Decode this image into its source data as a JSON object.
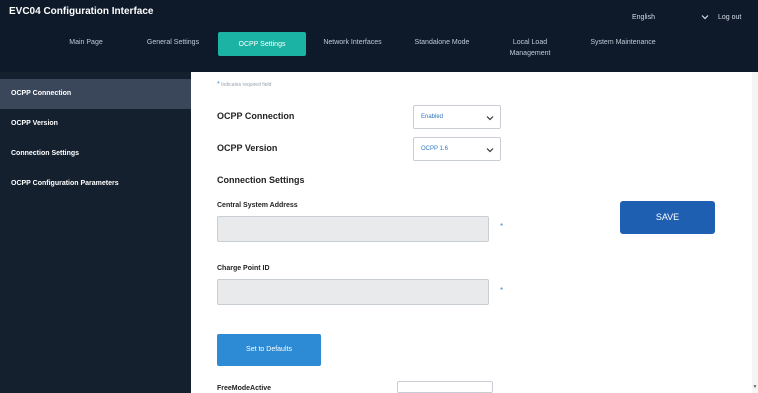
{
  "header": {
    "title": "EVC04 Configuration Interface",
    "language": "English",
    "logout": "Log out"
  },
  "nav": {
    "items": [
      {
        "label": "Main Page"
      },
      {
        "label": "General Settings"
      },
      {
        "label": "OCPP Settings",
        "active": true
      },
      {
        "label": "Network Interfaces"
      },
      {
        "label": "Standalone Mode"
      },
      {
        "label": "Local Load Management"
      },
      {
        "label": "System Maintenance"
      }
    ]
  },
  "sidebar": {
    "items": [
      {
        "label": "OCPP Connection",
        "active": true
      },
      {
        "label": "OCPP Version"
      },
      {
        "label": "Connection Settings"
      },
      {
        "label": "OCPP Configuration Parameters"
      }
    ]
  },
  "form": {
    "required_note": "Indicates required field",
    "ocpp_connection": {
      "label": "OCPP Connection",
      "value": "Enabled"
    },
    "ocpp_version": {
      "label": "OCPP Version",
      "value": "OCPP 1.6"
    },
    "connection_settings": {
      "label": "Connection Settings"
    },
    "central_system_address": {
      "label": "Central System Address",
      "value": ""
    },
    "charge_point_id": {
      "label": "Charge Point ID",
      "value": ""
    },
    "required_marker": "*",
    "next_field_label": "FreeModeActive"
  },
  "buttons": {
    "save": "SAVE",
    "set_defaults": "Set to Defaults"
  },
  "colors": {
    "header_bg": "#0e1a2a",
    "sidebar_bg": "#15202f",
    "active_tab": "#1bb3a4",
    "save_button": "#1f5fb2",
    "defaults_button": "#2d8ad4"
  },
  "icons": {
    "language_dropdown": "chevron-down-icon",
    "select_dropdown": "chevron-down-icon"
  }
}
